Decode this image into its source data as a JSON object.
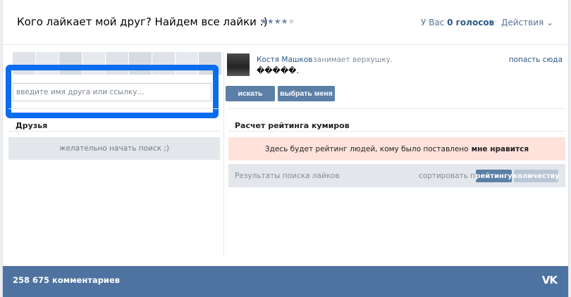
{
  "header": {
    "title": "Кого лайкает мой друг? Найдем все лайки :)",
    "stars": {
      "filled": 4,
      "total": 5
    },
    "votes_prefix": "У Вас ",
    "votes_count": "0 голосов",
    "separator": "·",
    "actions_label": "Действия ⌄"
  },
  "search": {
    "placeholder": "введите имя друга или ссылку..."
  },
  "feed": {
    "user": "Костя Машков",
    "action": "занимает верхушку.",
    "text": "�����.",
    "link": "попасть сюда"
  },
  "buttons": {
    "search": "искать",
    "choose_me": "выбрать меня"
  },
  "friends": {
    "title": "Друзья",
    "hint": "желательно начать поиск ;)"
  },
  "rating": {
    "title": "Расчет рейтинга кумиров",
    "banner_text": "Здесь будет рейтинг людей, кому было поставлено",
    "banner_bold": "мне нравится",
    "results_label": "Результаты поиска лайков",
    "sort_label": "сортировать по",
    "sort_rating": "рейтингу",
    "sort_count": "количеству"
  },
  "footer": {
    "comments": "258 675 комментариев",
    "logo": "VK"
  },
  "colors": {
    "accent": "#5b7fa6",
    "footer": "#4f73a0",
    "highlight": "#0a6cf0",
    "banner": "#ffe2dc"
  }
}
